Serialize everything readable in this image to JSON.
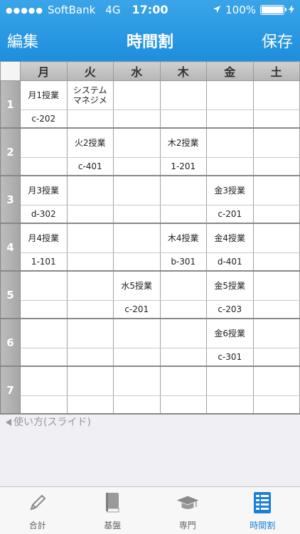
{
  "status": {
    "carrier": "SoftBank",
    "network": "4G",
    "time": "17:00",
    "battery": "100%",
    "battery_level": 1.0
  },
  "nav": {
    "left": "編集",
    "title": "時間割",
    "right": "保存"
  },
  "days": [
    "月",
    "火",
    "水",
    "木",
    "金",
    "土"
  ],
  "periods": [
    {
      "num": "1",
      "subjects": [
        "月1授業",
        "システム\nマネジメ",
        "",
        "",
        "",
        ""
      ],
      "rooms": [
        "c-202",
        "",
        "",
        "",
        "",
        ""
      ]
    },
    {
      "num": "2",
      "subjects": [
        "",
        "火2授業",
        "",
        "木2授業",
        "",
        ""
      ],
      "rooms": [
        "",
        "c-401",
        "",
        "1-201",
        "",
        ""
      ]
    },
    {
      "num": "3",
      "subjects": [
        "月3授業",
        "",
        "",
        "",
        "金3授業",
        ""
      ],
      "rooms": [
        "d-302",
        "",
        "",
        "",
        "c-201",
        ""
      ]
    },
    {
      "num": "4",
      "subjects": [
        "月4授業",
        "",
        "",
        "木4授業",
        "金4授業",
        ""
      ],
      "rooms": [
        "1-101",
        "",
        "",
        "b-301",
        "d-401",
        ""
      ]
    },
    {
      "num": "5",
      "subjects": [
        "",
        "",
        "水5授業",
        "",
        "金5授業",
        ""
      ],
      "rooms": [
        "",
        "",
        "c-201",
        "",
        "c-203",
        ""
      ]
    },
    {
      "num": "6",
      "subjects": [
        "",
        "",
        "",
        "",
        "金6授業",
        ""
      ],
      "rooms": [
        "",
        "",
        "",
        "",
        "c-301",
        ""
      ]
    },
    {
      "num": "7",
      "subjects": [
        "",
        "",
        "",
        "",
        "",
        ""
      ],
      "rooms": [
        "",
        "",
        "",
        "",
        "",
        ""
      ]
    }
  ],
  "howto": "使い方(スライド)",
  "tabs": [
    {
      "label": "合計",
      "icon": "pencil-icon",
      "active": false
    },
    {
      "label": "基盤",
      "icon": "book-icon",
      "active": false
    },
    {
      "label": "専門",
      "icon": "graduation-cap-icon",
      "active": false
    },
    {
      "label": "時間割",
      "icon": "timetable-icon",
      "active": true
    }
  ],
  "colors": {
    "accent": "#1e8fdd",
    "active_tab": "#1a7fd6"
  }
}
